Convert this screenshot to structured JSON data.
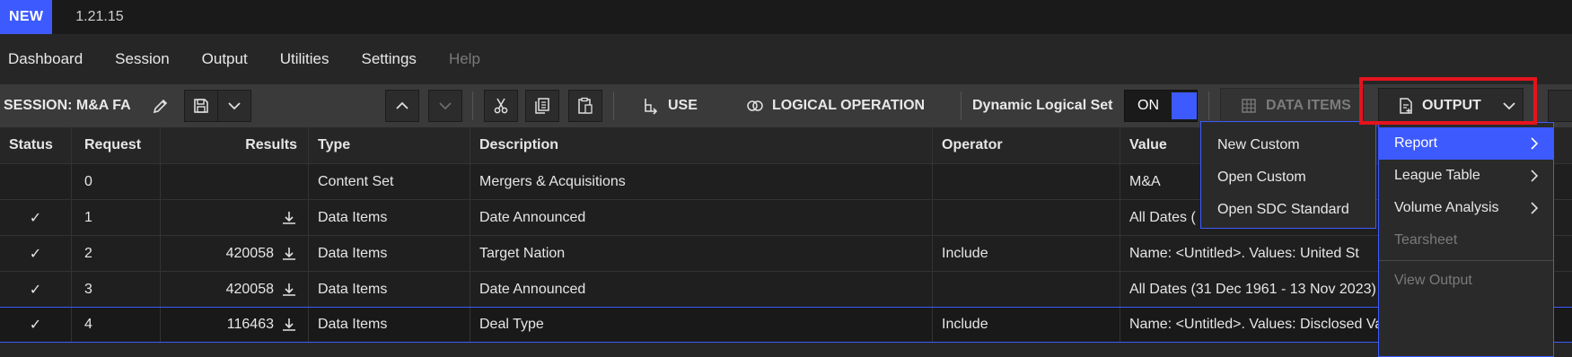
{
  "app": {
    "badge": "NEW",
    "version": "1.21.15"
  },
  "menubar": {
    "items": [
      {
        "label": "Dashboard"
      },
      {
        "label": "Session"
      },
      {
        "label": "Output"
      },
      {
        "label": "Utilities"
      },
      {
        "label": "Settings"
      },
      {
        "label": "Help",
        "disabled": true
      }
    ]
  },
  "toolbar": {
    "session_label": "SESSION: M&A FA",
    "use_label": "USE",
    "logical_label": "LOGICAL OPERATION",
    "dynamic_label": "Dynamic Logical Set",
    "toggle_label": "ON",
    "data_items_label": "DATA ITEMS",
    "output_label": "OUTPUT"
  },
  "table": {
    "headers": {
      "status": "Status",
      "request": "Request",
      "results": "Results",
      "type": "Type",
      "description": "Description",
      "operator": "Operator",
      "value": "Value"
    },
    "rows": [
      {
        "status": "",
        "request": "0",
        "results": "",
        "type": "Content Set",
        "description": "Mergers & Acquisitions",
        "operator": "",
        "value": "M&A"
      },
      {
        "status": "✓",
        "request": "1",
        "results": "",
        "type": "Data Items",
        "description": "Date Announced",
        "operator": "",
        "value": "All Dates ("
      },
      {
        "status": "✓",
        "request": "2",
        "results": "420058",
        "type": "Data Items",
        "description": "Target Nation",
        "operator": "Include",
        "value": "Name: <Untitled>. Values: United St"
      },
      {
        "status": "✓",
        "request": "3",
        "results": "420058",
        "type": "Data Items",
        "description": "Date Announced",
        "operator": "",
        "value": "All Dates (31 Dec 1961 - 13 Nov 2023)"
      },
      {
        "status": "✓",
        "request": "4",
        "results": "116463",
        "type": "Data Items",
        "description": "Deal Type",
        "operator": "Include",
        "value": "Name: <Untitled>. Values: Disclosed Value"
      }
    ]
  },
  "output_menu": {
    "items": [
      {
        "label": "Report",
        "has_submenu": true,
        "active": true
      },
      {
        "label": "League Table",
        "has_submenu": true
      },
      {
        "label": "Volume Analysis",
        "has_submenu": true
      },
      {
        "label": "Tearsheet",
        "disabled": true
      },
      {
        "label": "View Output",
        "disabled": true
      }
    ]
  },
  "report_submenu": {
    "items": [
      {
        "label": "New Custom"
      },
      {
        "label": "Open Custom"
      },
      {
        "label": "Open SDC Standard"
      }
    ]
  },
  "colors": {
    "accent": "#3d5afe",
    "highlight": "#e5131d",
    "background": "#262626",
    "toolbar": "#3a3a3a"
  }
}
